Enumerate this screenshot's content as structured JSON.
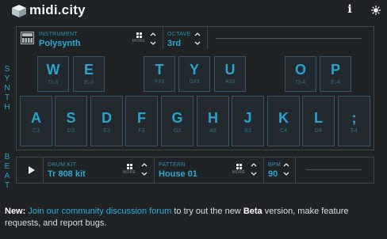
{
  "header": {
    "app_name": "midi.city",
    "logo_icon": "cube-icon",
    "info_icon": "info-icon",
    "theme_icon": "light-icon"
  },
  "synth": {
    "side_label": [
      "S",
      "Y",
      "N",
      "T",
      "H"
    ],
    "instrument": {
      "label": "INSTRUMENT",
      "value": "Polysynth",
      "icon": "keyboard-icon",
      "more_label": "MORE"
    },
    "octave": {
      "label": "OCTAVE",
      "value": "3rd"
    },
    "volume_slider": "volume-slider",
    "black_keys": [
      {
        "key": "W",
        "note": "D♭3"
      },
      {
        "key": "E",
        "note": "E♭3"
      },
      {
        "key": "T",
        "note": "F♯3"
      },
      {
        "key": "Y",
        "note": "G♯3"
      },
      {
        "key": "U",
        "note": "A♯3"
      },
      {
        "key": "O",
        "note": "D♭4"
      },
      {
        "key": "P",
        "note": "E♭4"
      }
    ],
    "white_keys": [
      {
        "key": "A",
        "note": "C3"
      },
      {
        "key": "S",
        "note": "D3"
      },
      {
        "key": "D",
        "note": "E3"
      },
      {
        "key": "F",
        "note": "F3"
      },
      {
        "key": "G",
        "note": "G3"
      },
      {
        "key": "H",
        "note": "A3"
      },
      {
        "key": "J",
        "note": "B3"
      },
      {
        "key": "K",
        "note": "C4"
      },
      {
        "key": "L",
        "note": "D4"
      },
      {
        "key": ";",
        "note": "E4"
      }
    ]
  },
  "beat": {
    "side_label": [
      "B",
      "E",
      "A",
      "T"
    ],
    "drum_kit": {
      "label": "DRUM KIT",
      "value": "Tr 808 kit",
      "more_label": "MORE"
    },
    "pattern": {
      "label": "PATTERN",
      "value": "House 01",
      "more_label": "MORE"
    },
    "bpm": {
      "label": "BPM",
      "value": "90"
    }
  },
  "footer": {
    "prefix": "New:",
    "link_text": "Join our community discussion forum",
    "middle": "to try out the new",
    "beta": "Beta",
    "suffix": "version, make feature requests, and report bugs."
  },
  "colors": {
    "background": "#1f2326",
    "accent": "#2ea9d2",
    "panel_border": "#3a454c"
  }
}
